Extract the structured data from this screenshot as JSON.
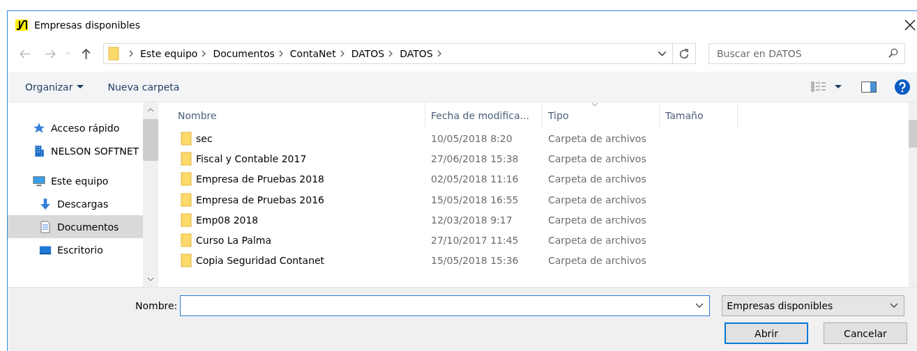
{
  "window": {
    "title": "Empresas disponibles"
  },
  "address_bar": {
    "path": [
      "Este equipo",
      "Documentos",
      "ContaNet",
      "DATOS",
      "DATOS"
    ]
  },
  "search": {
    "placeholder": "Buscar en DATOS"
  },
  "toolbar": {
    "organize": "Organizar",
    "new_folder": "Nueva carpeta"
  },
  "sidebar": {
    "items": [
      {
        "label": "Acceso rápido",
        "kind": "quick",
        "selected": false
      },
      {
        "label": "NELSON SOFTNET",
        "kind": "network",
        "selected": false
      },
      {
        "label": "Este equipo",
        "kind": "computer",
        "selected": false
      },
      {
        "label": "Descargas",
        "kind": "downloads",
        "selected": false
      },
      {
        "label": "Documentos",
        "kind": "documents",
        "selected": true
      },
      {
        "label": "Escritorio",
        "kind": "desktop",
        "selected": false
      }
    ]
  },
  "table": {
    "columns": [
      {
        "label": "Nombre",
        "sorted": false
      },
      {
        "label": "Fecha de modifica...",
        "sorted": false
      },
      {
        "label": "Tipo",
        "sorted": true
      },
      {
        "label": "Tamaño",
        "sorted": false
      }
    ],
    "rows": [
      {
        "name": "sec",
        "date": "10/05/2018 8:20",
        "type": "Carpeta de archivos"
      },
      {
        "name": "Fiscal y Contable 2017",
        "date": "27/06/2018 15:38",
        "type": "Carpeta de archivos"
      },
      {
        "name": "Empresa de Pruebas 2018",
        "date": "02/05/2018 11:16",
        "type": "Carpeta de archivos"
      },
      {
        "name": "Empresa de Pruebas 2016",
        "date": "15/05/2018 16:55",
        "type": "Carpeta de archivos"
      },
      {
        "name": "Emp08 2018",
        "date": "12/03/2018 9:17",
        "type": "Carpeta de archivos"
      },
      {
        "name": "Curso La Palma",
        "date": "27/10/2017 11:45",
        "type": "Carpeta de archivos"
      },
      {
        "name": "Copia Seguridad Contanet",
        "date": "15/05/2018 15:36",
        "type": "Carpeta de archivos"
      }
    ]
  },
  "footer": {
    "name_label": "Nombre:",
    "filter": "Empresas disponibles",
    "buttons": [
      {
        "label": "Abrir",
        "default": true
      },
      {
        "label": "Cancelar",
        "default": false
      }
    ]
  }
}
